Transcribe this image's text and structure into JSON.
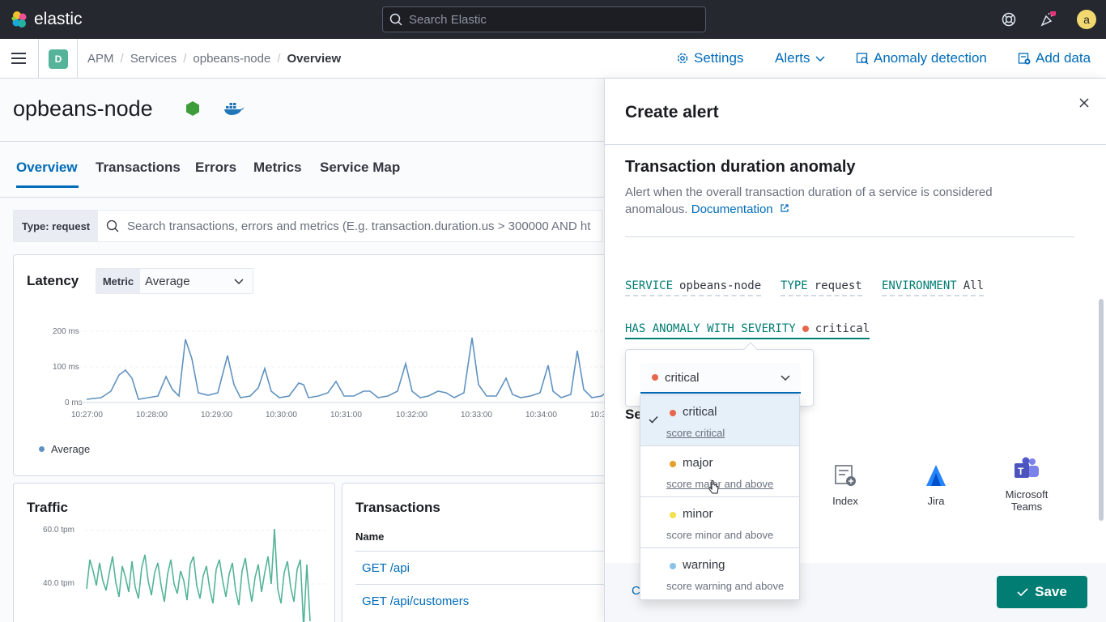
{
  "header": {
    "logo_text": "elastic",
    "search_placeholder": "Search Elastic",
    "avatar_initial": "a"
  },
  "subheader": {
    "space_initial": "D",
    "breadcrumbs": [
      "APM",
      "Services",
      "opbeans-node",
      "Overview"
    ],
    "settings_label": "Settings",
    "alerts_label": "Alerts",
    "anomaly_label": "Anomaly detection",
    "add_data_label": "Add data"
  },
  "service": {
    "name": "opbeans-node",
    "tabs": [
      "Overview",
      "Transactions",
      "Errors",
      "Metrics",
      "Service Map"
    ],
    "query_prepend": "Type: request",
    "query_placeholder": "Search transactions, errors and metrics (E.g. transaction.duration.us > 300000 AND ht"
  },
  "latency": {
    "title": "Latency",
    "metric_label": "Metric",
    "metric_value": "Average",
    "y_ticks": [
      "200 ms",
      "100 ms",
      "0 ms"
    ],
    "x_ticks": [
      "10:27:00",
      "10:28:00",
      "10:29:00",
      "10:30:00",
      "10:31:00",
      "10:32:00",
      "10:33:00",
      "10:34:00",
      "10:3"
    ],
    "legend": "Average",
    "color": "#6092c0"
  },
  "traffic": {
    "title": "Traffic",
    "y_ticks": [
      "60.0 tpm",
      "40.0 tpm"
    ],
    "color": "#54b399"
  },
  "transactions": {
    "title": "Transactions",
    "column": "Name",
    "rows": [
      "GET /api",
      "GET /api/customers"
    ]
  },
  "flyout": {
    "title": "Create alert",
    "alert_type": "Transaction duration anomaly",
    "description": "Alert when the overall transaction duration of a service is considered anomalous.",
    "doc_link": "Documentation",
    "expressions": {
      "service_key": "SERVICE",
      "service_val": "opbeans-node",
      "type_key": "TYPE",
      "type_val": "request",
      "env_key": "ENVIRONMENT",
      "env_val": "All",
      "severity_key": "HAS ANOMALY WITH SEVERITY",
      "severity_val": "critical"
    },
    "severity_select_value": "critical",
    "severity_options": [
      {
        "name": "critical",
        "desc": "score critical",
        "color": "#e7664c"
      },
      {
        "name": "major",
        "desc": "score major and above",
        "color": "#e79f2c"
      },
      {
        "name": "minor",
        "desc": "score minor and above",
        "color": "#f2e14a"
      },
      {
        "name": "warning",
        "desc": "score warning and above",
        "color": "#8ac3e8"
      }
    ],
    "section_label": "Se",
    "connectors": [
      "Index",
      "Jira",
      "Microsoft Teams"
    ],
    "cancel_label": "C",
    "save_label": "Save"
  }
}
